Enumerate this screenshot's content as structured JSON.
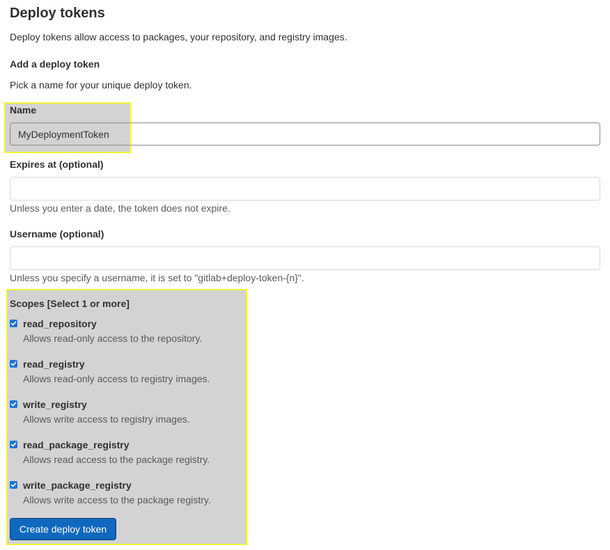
{
  "header": {
    "title": "Deploy tokens",
    "description": "Deploy tokens allow access to packages, your repository, and registry images."
  },
  "form": {
    "subtitle": "Add a deploy token",
    "subtitle_help": "Pick a name for your unique deploy token.",
    "name": {
      "label": "Name",
      "value": "MyDeploymentToken"
    },
    "expires": {
      "label": "Expires at (optional)",
      "value": "",
      "help": "Unless you enter a date, the token does not expire."
    },
    "username": {
      "label": "Username (optional)",
      "value": "",
      "help": "Unless you specify a username, it is set to \"gitlab+deploy-token-{n}\"."
    },
    "scopes": {
      "label": "Scopes [Select 1 or more]",
      "items": [
        {
          "name": "read_repository",
          "description": "Allows read-only access to the repository.",
          "checked": true
        },
        {
          "name": "read_registry",
          "description": "Allows read-only access to registry images.",
          "checked": true
        },
        {
          "name": "write_registry",
          "description": "Allows write access to registry images.",
          "checked": true
        },
        {
          "name": "read_package_registry",
          "description": "Allows read access to the package registry.",
          "checked": true
        },
        {
          "name": "write_package_registry",
          "description": "Allows write access to the package registry.",
          "checked": true
        }
      ]
    },
    "submit_label": "Create deploy token"
  },
  "colors": {
    "accent": "#1f75cb",
    "button": "#1068bf",
    "highlight_fill": "#d3d3d3",
    "highlight_border": "#f2f23a"
  }
}
